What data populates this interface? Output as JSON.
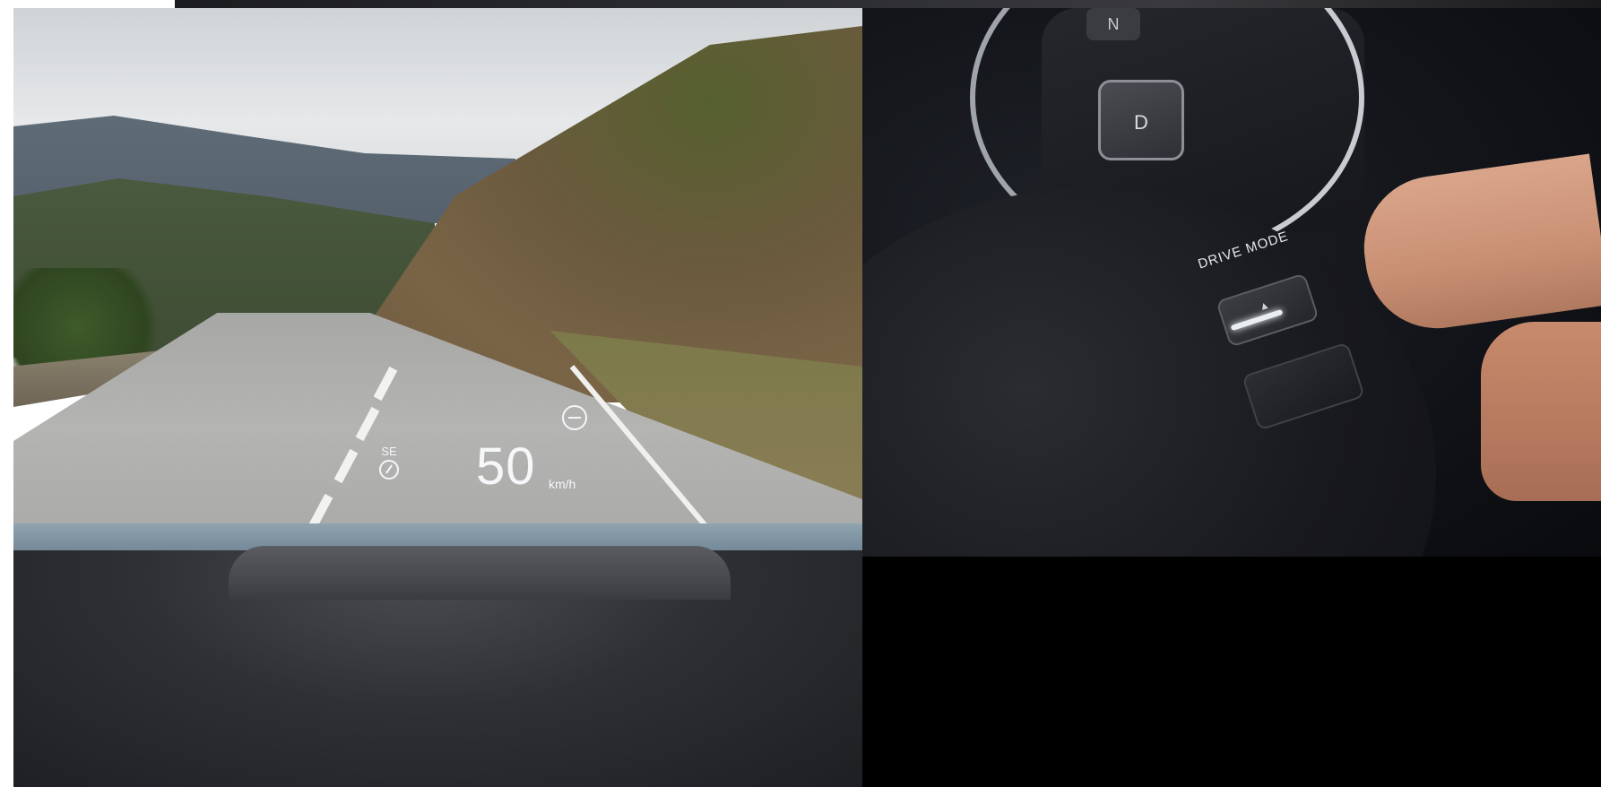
{
  "left_photo": {
    "hud": {
      "compass_direction": "SE",
      "speed": "50",
      "unit": "km/h"
    }
  },
  "right_photo": {
    "gear_n": "N",
    "gear_d": "D",
    "drive_mode_label": "DRIVE MODE"
  }
}
